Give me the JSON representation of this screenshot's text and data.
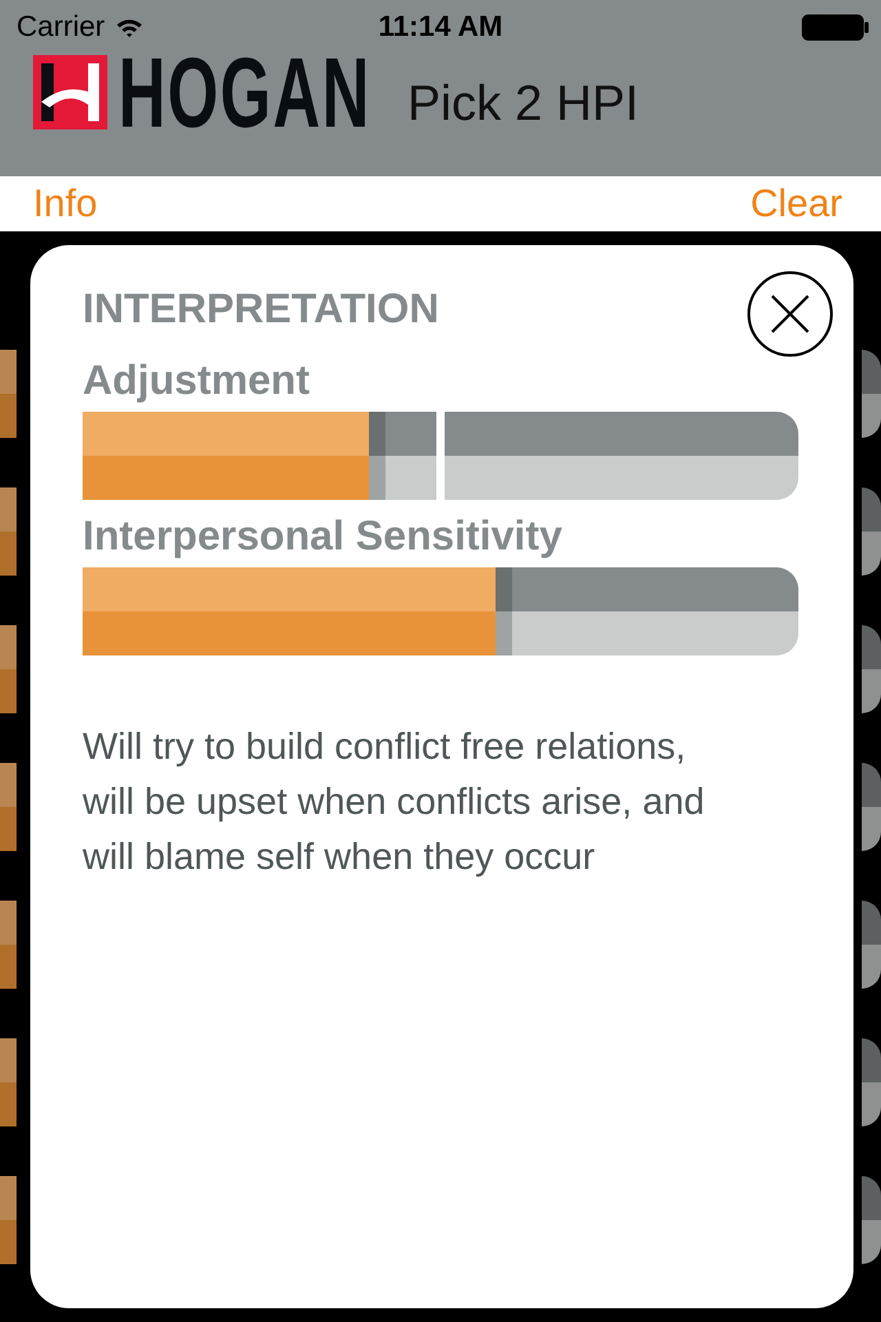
{
  "status_bar": {
    "carrier": "Carrier",
    "time": "11:14 AM"
  },
  "header": {
    "logo": "HOGAN",
    "title": "Pick 2 HPI"
  },
  "nav": {
    "left": "Info",
    "right": "Clear"
  },
  "modal": {
    "title": "INTERPRETATION",
    "scales": [
      {
        "name": "Adjustment",
        "level": 0.4,
        "split": {
          "level": 0.5
        }
      },
      {
        "name": "Interpersonal Sensitivity",
        "level": 0.577
      }
    ],
    "text": "Will try to build conflict free relations, will be upset when conflicts arise, and will blame self when they occur"
  }
}
